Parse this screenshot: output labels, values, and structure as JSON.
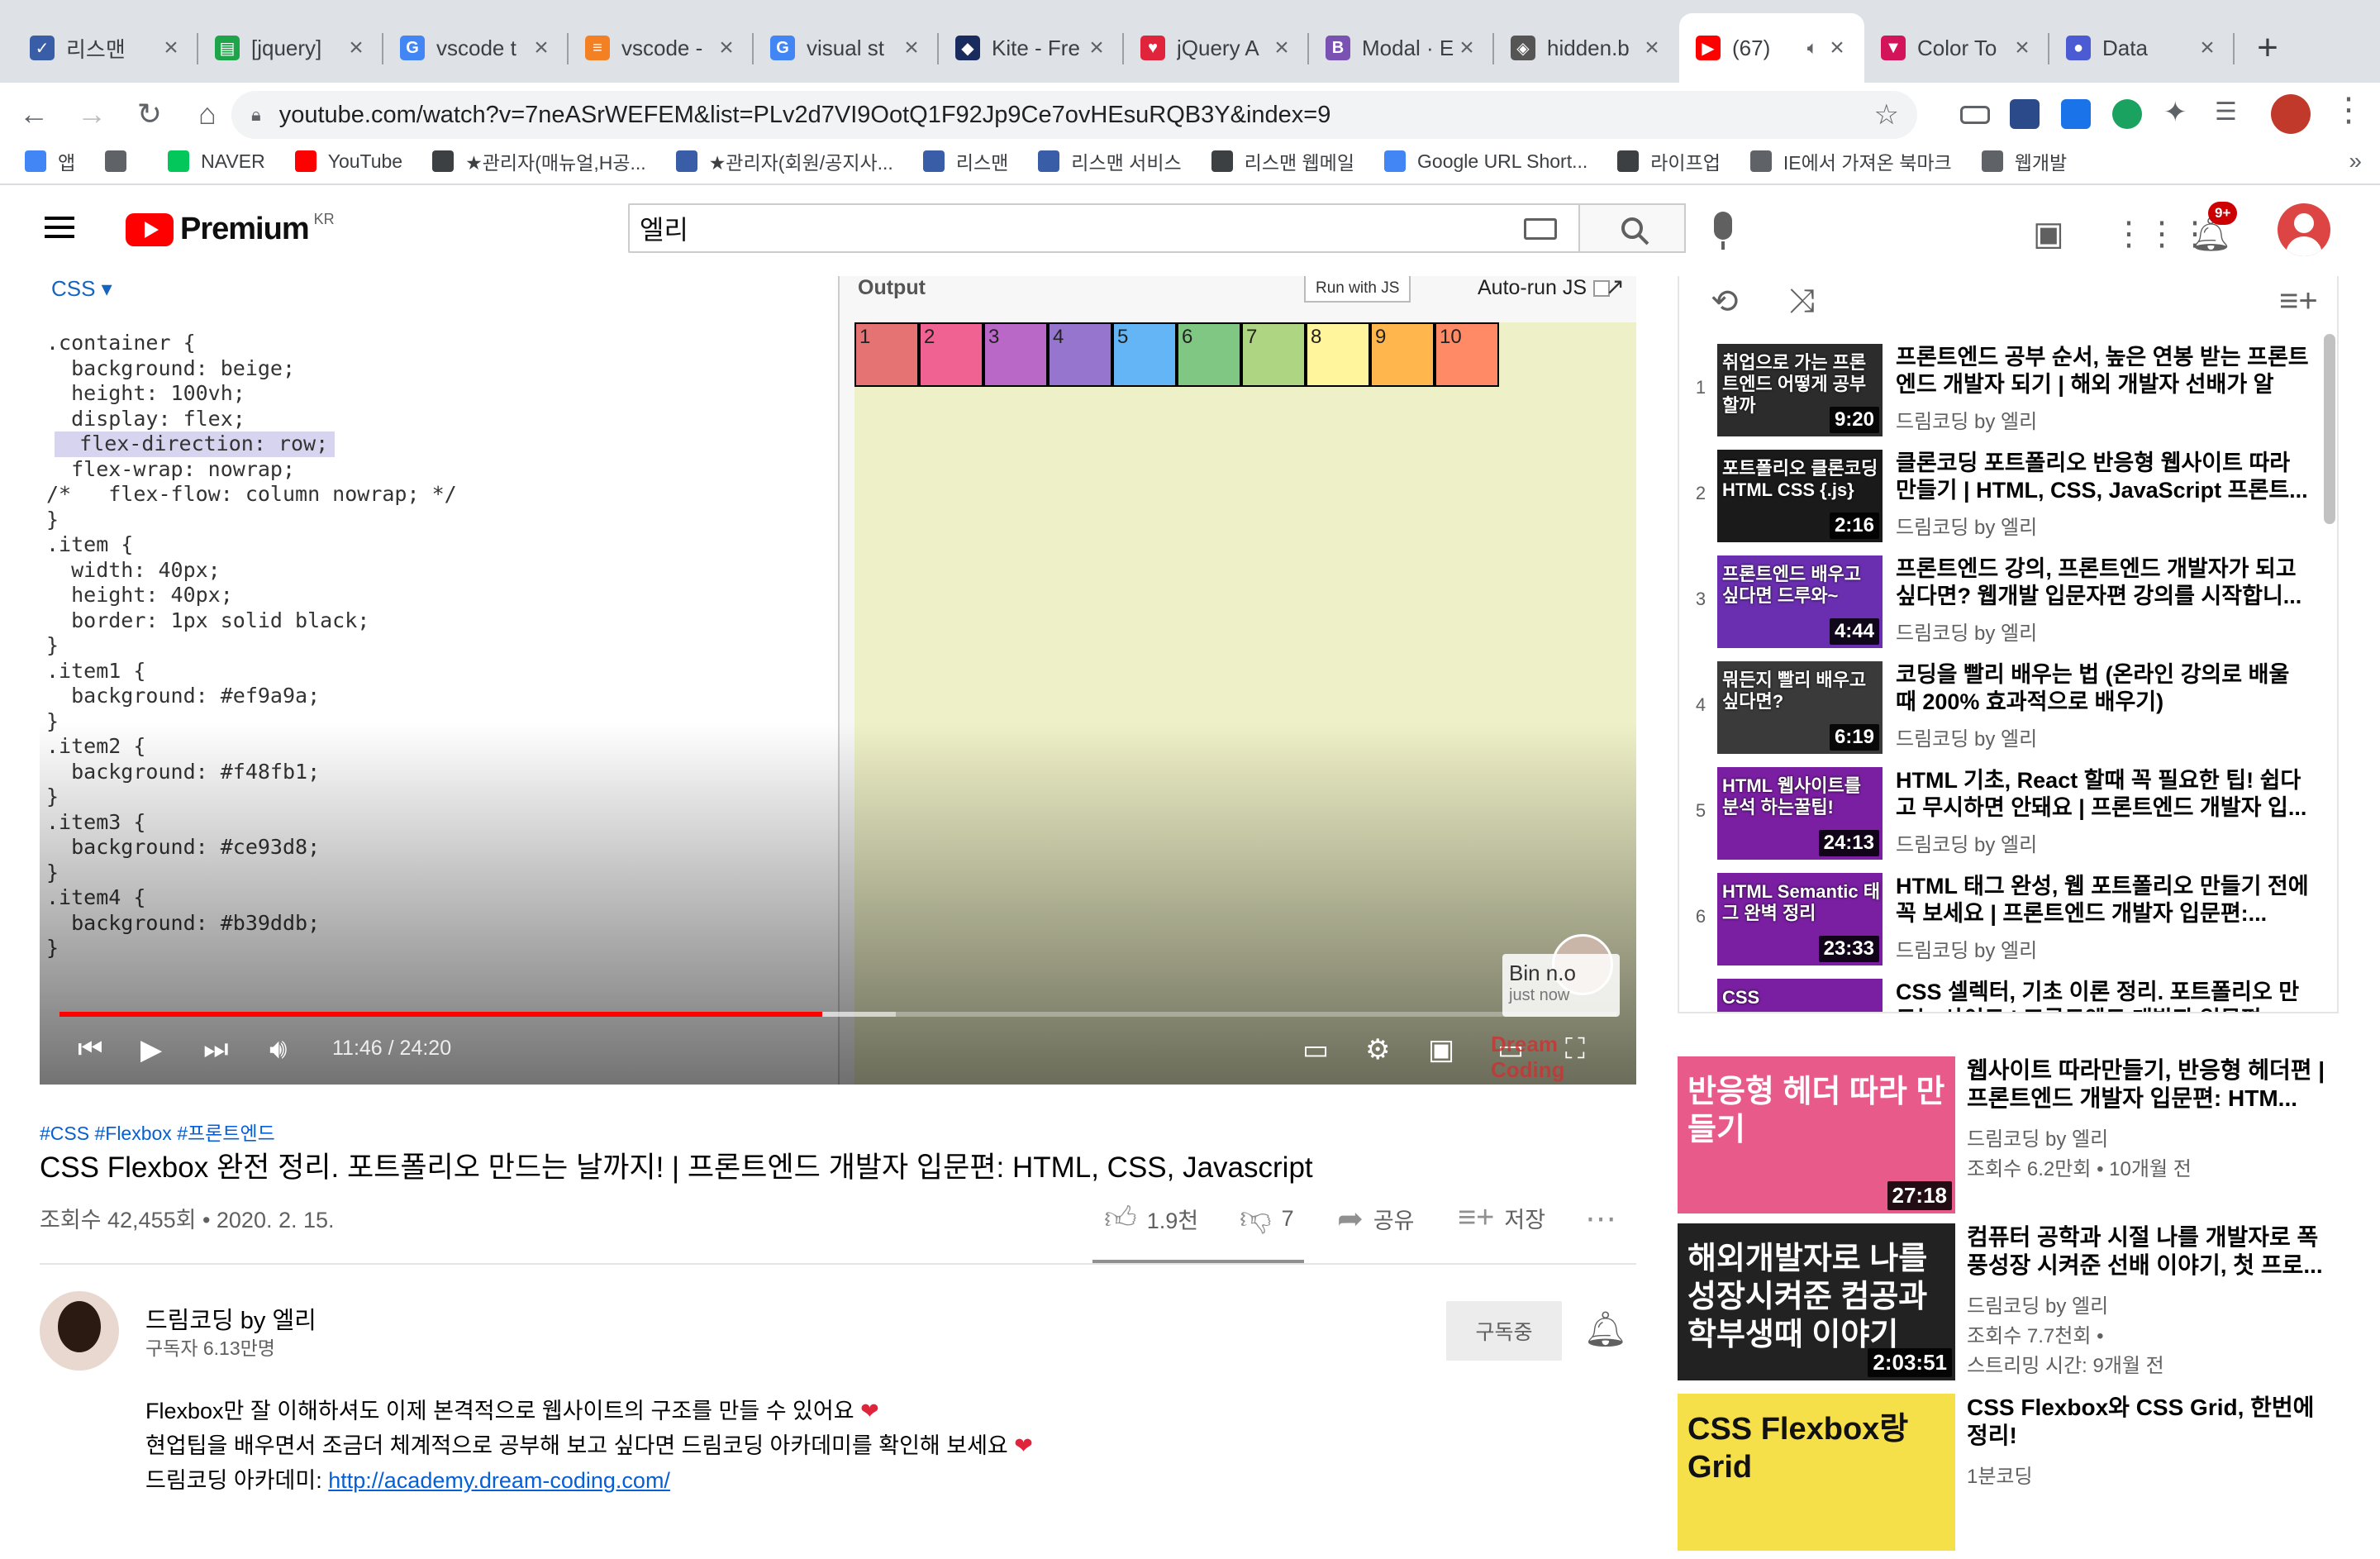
{
  "browser": {
    "tabs": [
      {
        "title": "리스맨",
        "color": "#3a5da8",
        "glyph": "✓"
      },
      {
        "title": "[jquery]",
        "color": "#1ea54a",
        "glyph": "▤"
      },
      {
        "title": "vscode t",
        "color": "#4285f4",
        "glyph": "G"
      },
      {
        "title": "vscode -",
        "color": "#f48024",
        "glyph": "≡"
      },
      {
        "title": "visual st",
        "color": "#4285f4",
        "glyph": "G"
      },
      {
        "title": "Kite - Fre",
        "color": "#1a2b5e",
        "glyph": "◆"
      },
      {
        "title": "jQuery A",
        "color": "#e0243b",
        "glyph": "♥"
      },
      {
        "title": "Modal · E",
        "color": "#7952b3",
        "glyph": "B"
      },
      {
        "title": "hidden.b",
        "color": "#555555",
        "glyph": "◈"
      },
      {
        "title": "(67)",
        "color": "#ff0000",
        "glyph": "▶"
      },
      {
        "title": "Color To",
        "color": "#d4145a",
        "glyph": "▼"
      },
      {
        "title": "Data",
        "color": "#4a5bd4",
        "glyph": "●"
      }
    ],
    "url": "youtube.com/watch?v=7neASrWEFEM&list=PLv2d7VI9OotQ1F92Jp9Ce7ovHEsuRQB3Y&index=9",
    "bookmarks": [
      {
        "label": "앱",
        "color": "#4285f4"
      },
      {
        "label": "",
        "color": "#5f6368"
      },
      {
        "label": "NAVER",
        "color": "#03c75a"
      },
      {
        "label": "YouTube",
        "color": "#ff0000"
      },
      {
        "label": "★관리자(매뉴얼,H공...",
        "color": "#3c4043"
      },
      {
        "label": "★관리자(회원/공지사...",
        "color": "#3a5da8"
      },
      {
        "label": "리스맨",
        "color": "#3a5da8"
      },
      {
        "label": "리스맨 서비스",
        "color": "#3a5da8"
      },
      {
        "label": "리스맨 웹메일",
        "color": "#3c4043"
      },
      {
        "label": "Google URL Short...",
        "color": "#4285f4"
      },
      {
        "label": "라이프업",
        "color": "#3c4043"
      },
      {
        "label": "IE에서 가져온 북마크",
        "color": "#5f6368"
      },
      {
        "label": "웹개발",
        "color": "#5f6368"
      }
    ],
    "bookmarks_more": "»"
  },
  "youtube": {
    "logo_text": "Premium",
    "region": "KR",
    "search_value": "엘리",
    "notif_count": "9+"
  },
  "video": {
    "code_header": "CSS ▾",
    "code_lines": [
      ".container {",
      "  background: beige;",
      "  height: 100vh;",
      "  display: flex;",
      "  flex-direction: row;",
      "  flex-wrap: nowrap;",
      "/*   flex-flow: column nowrap; */",
      "",
      "}",
      "",
      ".item {",
      "  width: 40px;",
      "  height: 40px;",
      "  border: 1px solid black;",
      "}",
      "",
      ".item1 {",
      "  background: #ef9a9a;",
      "}",
      ".item2 {",
      "  background: #f48fb1;",
      "}",
      ".item3 {",
      "  background: #ce93d8;",
      "}",
      ".item4 {",
      "  background: #b39ddb;",
      "}"
    ],
    "output_label": "Output",
    "run_js": "Run with JS",
    "auto_run": "Auto-run JS",
    "items": [
      {
        "n": "1",
        "color": "#e57373"
      },
      {
        "n": "2",
        "color": "#f06292"
      },
      {
        "n": "3",
        "color": "#ba68c8"
      },
      {
        "n": "4",
        "color": "#9575cd"
      },
      {
        "n": "5",
        "color": "#64b5f6"
      },
      {
        "n": "6",
        "color": "#81c784"
      },
      {
        "n": "7",
        "color": "#aed581"
      },
      {
        "n": "8",
        "color": "#fff59d"
      },
      {
        "n": "9",
        "color": "#ffb74d"
      },
      {
        "n": "10",
        "color": "#ff8a65"
      }
    ],
    "progress": 0.49,
    "time": "11:46 / 24:20",
    "notif_name": "Bin n.o",
    "notif_time": "just now",
    "watermark": "Dream Coding"
  },
  "meta": {
    "tags": "#CSS #Flexbox #프론트엔드",
    "title": "CSS Flexbox 완전 정리. 포트폴리오 만드는 날까지! | 프론트엔드 개발자 입문편: HTML, CSS, Javascript",
    "views_date": "조회수 42,455회 • 2020. 2. 15.",
    "likes": "1.9천",
    "dislikes": "7",
    "share": "공유",
    "save": "저장",
    "channel": "드림코딩 by 엘리",
    "subscribers": "구독자 6.13만명",
    "subscribe_btn": "구독중",
    "desc_lines": [
      "Flexbox만 잘 이해하셔도 이제 본격적으로 웹사이트의 구조를 만들 수 있어요",
      "현업팁을 배우면서 조금더 체계적으로 공부해 보고 싶다면 드림코딩 아카데미를 확인해 보세요"
    ],
    "desc_link_label": "드림코딩 아카데미:",
    "desc_link": "http://academy.dream-coding.com/"
  },
  "playlist": [
    {
      "idx": "1",
      "title": "프론트엔드 공부 순서, 높은 연봉 받는 프론트엔드 개발자 되기 | 해외 개발자 선배가 알려...",
      "channel": "드림코딩 by 엘리",
      "duration": "9:20",
      "thumb_text": "취업으로 가는 프론트엔드 어떻게 공부할까",
      "bg": "#2c2c2c"
    },
    {
      "idx": "2",
      "title": "클론코딩 포트폴리오 반응형 웹사이트 따라 만들기 | HTML, CSS, JavaScript 프론트...",
      "channel": "드림코딩 by 엘리",
      "duration": "2:16",
      "thumb_text": "포트폴리오 클론코딩 HTML CSS {.js}",
      "bg": "#1a1a1a"
    },
    {
      "idx": "3",
      "title": "프론트엔드 강의, 프론트엔드 개발자가 되고 싶다면? 웹개발 입문자편 강의를 시작합니...",
      "channel": "드림코딩 by 엘리",
      "duration": "4:44",
      "thumb_text": "프론트엔드 배우고 싶다면 드루와~",
      "bg": "#6a2fb0"
    },
    {
      "idx": "4",
      "title": "코딩을 빨리 배우는 법 (온라인 강의로 배울때 200% 효과적으로 배우기)",
      "channel": "드림코딩 by 엘리",
      "duration": "6:19",
      "thumb_text": "뭐든지 빨리 배우고 싶다면?",
      "bg": "#3a3a3a"
    },
    {
      "idx": "5",
      "title": "HTML 기초, React 할때 꼭 필요한 팁! 쉽다고 무시하면 안돼요 | 프론트엔드 개발자 입...",
      "channel": "드림코딩 by 엘리",
      "duration": "24:13",
      "thumb_text": "HTML 웹사이트를 분석 하는꿀팁!",
      "bg": "#7a1fa2"
    },
    {
      "idx": "6",
      "title": "HTML 태그 완성, 웹 포트폴리오 만들기 전에 꼭 보세요 | 프론트엔드 개발자 입문편:...",
      "channel": "드림코딩 by 엘리",
      "duration": "23:33",
      "thumb_text": "HTML Semantic 태그 완벽 정리",
      "bg": "#7a1fa2"
    },
    {
      "idx": "",
      "title": "CSS 셀렉터, 기초 이론 정리. 포트폴리오 만드는 사이트 | 프론트엔드 개발자 입문편",
      "channel": "",
      "duration": "",
      "thumb_text": "CSS",
      "bg": "#7a1fa2"
    }
  ],
  "recommendations": [
    {
      "title": "웹사이트 따라만들기, 반응형 헤더편 | 프론트엔드 개발자 입문편: HTM...",
      "channel": "드림코딩 by 엘리",
      "meta": "조회수 6.2만회 • 10개월 전",
      "meta2": "",
      "duration": "27:18",
      "thumb_text": "반응형 헤더 따라 만들기",
      "bg": "#e85a8a"
    },
    {
      "title": "컴퓨터 공학과 시절 나를 개발자로 폭풍성장 시켜준 선배 이야기, 첫 프로...",
      "channel": "드림코딩 by 엘리",
      "meta": "조회수 7.7천회 •",
      "meta2": "스트리밍 시간: 9개월 전",
      "duration": "2:03:51",
      "thumb_text": "해외개발자로 나를 성장시켜준 컴공과 학부생때 이야기",
      "bg": "#222"
    },
    {
      "title": "CSS Flexbox와 CSS Grid, 한번에 정리!",
      "channel": "1분코딩",
      "meta": "",
      "meta2": "",
      "duration": "",
      "thumb_text": "CSS Flexbox랑 Grid",
      "bg": "#f5e04a"
    }
  ]
}
